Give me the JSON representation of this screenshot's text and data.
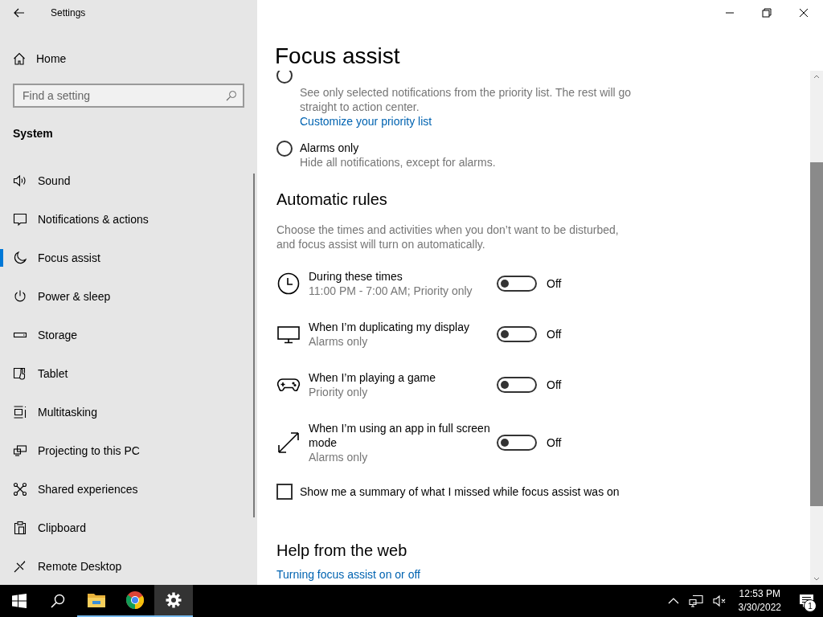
{
  "window": {
    "title": "Settings"
  },
  "sidebar": {
    "home": "Home",
    "search": {
      "placeholder": "Find a setting"
    },
    "section": "System",
    "items": [
      {
        "label": "Sound",
        "selected": false
      },
      {
        "label": "Notifications & actions",
        "selected": false
      },
      {
        "label": "Focus assist",
        "selected": true
      },
      {
        "label": "Power & sleep",
        "selected": false
      },
      {
        "label": "Storage",
        "selected": false
      },
      {
        "label": "Tablet",
        "selected": false
      },
      {
        "label": "Multitasking",
        "selected": false
      },
      {
        "label": "Projecting to this PC",
        "selected": false
      },
      {
        "label": "Shared experiences",
        "selected": false
      },
      {
        "label": "Clipboard",
        "selected": false
      },
      {
        "label": "Remote Desktop",
        "selected": false
      }
    ]
  },
  "page": {
    "title": "Focus assist",
    "options": [
      {
        "selected": false,
        "description": "See only selected notifications from the priority list. The rest will go straight to action center.",
        "link": "Customize your priority list"
      },
      {
        "label": "Alarms only",
        "selected": false,
        "description": "Hide all notifications, except for alarms."
      }
    ],
    "rules": {
      "heading": "Automatic rules",
      "intro": "Choose the times and activities when you don’t want to be disturbed, and focus assist will turn on automatically.",
      "items": [
        {
          "title": "During these times",
          "subtitle": "11:00 PM - 7:00 AM; Priority only",
          "on": false,
          "state": "Off"
        },
        {
          "title": "When I’m duplicating my display",
          "subtitle": "Alarms only",
          "on": false,
          "state": "Off"
        },
        {
          "title": "When I’m playing a game",
          "subtitle": "Priority only",
          "on": false,
          "state": "Off"
        },
        {
          "title": "When I’m using an app in full screen mode",
          "subtitle": "Alarms only",
          "on": false,
          "state": "Off"
        }
      ]
    },
    "summary": {
      "label": "Show me a summary of what I missed while focus assist was on",
      "checked": false
    },
    "help": {
      "heading": "Help from the web",
      "links": [
        "Turning focus assist on or off"
      ]
    }
  },
  "taskbar": {
    "apps": [
      {
        "running": true,
        "selected": false
      },
      {
        "running": true,
        "selected": false
      },
      {
        "running": true,
        "selected": true
      }
    ],
    "time": "12:53 PM",
    "date": "3/30/2022",
    "notifications": "1"
  }
}
